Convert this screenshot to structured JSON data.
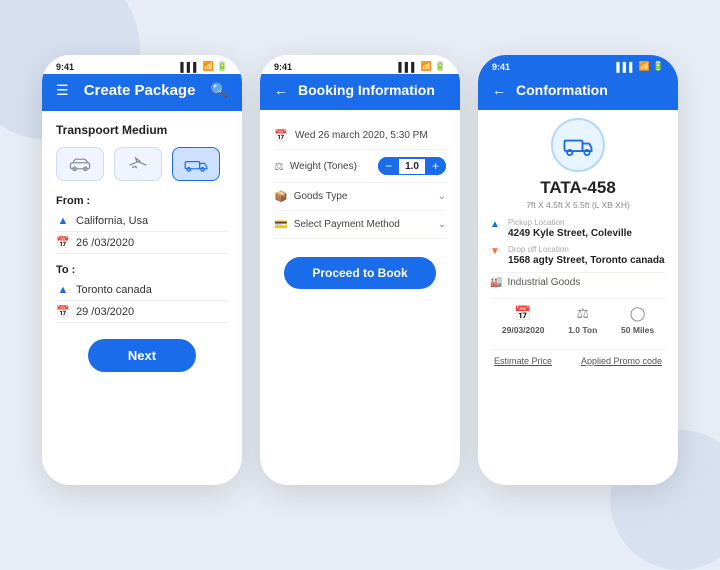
{
  "colors": {
    "primary": "#1a6ceb",
    "bg": "#e8edf5",
    "white": "#fff"
  },
  "left": {
    "status_time": "9:41",
    "header_title": "Create Package",
    "transport_label": "Transpoort Medium",
    "transport_options": [
      "car",
      "plane",
      "truck"
    ],
    "from_label": "From :",
    "from_location": "California, Usa",
    "from_date": "26 /03/2020",
    "to_label": "To :",
    "to_location": "Toronto canada",
    "to_date": "29 /03/2020",
    "next_btn": "Next"
  },
  "mid": {
    "status_time": "9:41",
    "header_title": "Booking Information",
    "datetime": "Wed 26 march 2020,  5:30 PM",
    "weight_label": "Weight (Tones)",
    "weight_value": "1.0",
    "goods_type_label": "Goods Type",
    "payment_label": "Select Payment Method",
    "proceed_btn": "Proceed to Book"
  },
  "right": {
    "status_time": "9:41",
    "header_title": "Conformation",
    "vehicle_name": "TATA-458",
    "vehicle_dims": "7ft X 4.5ft X 5.5ft (L XB XH)",
    "pickup_label": "Pickup Location",
    "pickup_value": "4249 Kyle Street, Coleville",
    "dropoff_label": "Drop off Location",
    "dropoff_value": "1568 agty Street, Toronto canada",
    "goods_label": "Industrial Goods",
    "stat1_value": "29/03/2020",
    "stat2_value": "1.0 Ton",
    "stat3_value": "50 Miles",
    "estimate_label": "Estimate Price",
    "promo_label": "Applied Promo code"
  }
}
